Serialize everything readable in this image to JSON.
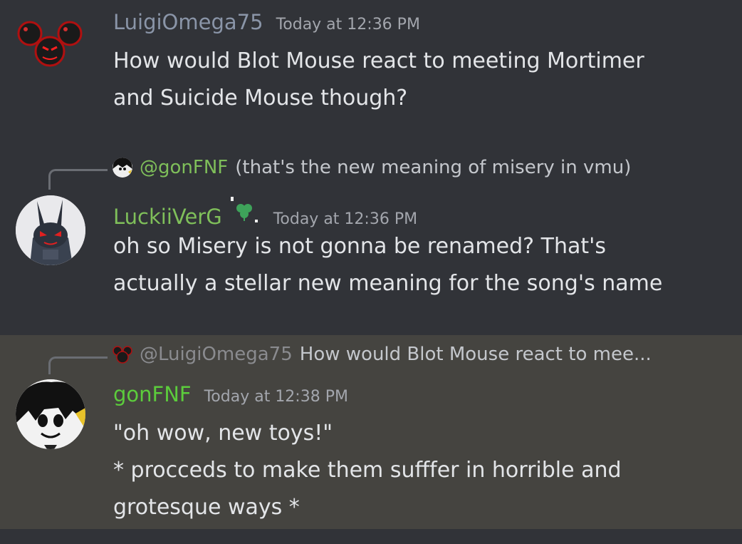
{
  "messages": [
    {
      "author": "LuigiOmega75",
      "author_color": "#8a95a8",
      "timestamp": "Today at 12:36 PM",
      "lines": [
        "How would Blot Mouse react to meeting Mortimer",
        "and Suicide Mouse though?"
      ]
    },
    {
      "reply": {
        "mention": "@gonFNF",
        "text": "(that's the new meaning of misery in vmu)"
      },
      "author": "LuckiiVerG",
      "author_color": "#7fbf5a",
      "timestamp": "Today at 12:36 PM",
      "lines": [
        "oh so Misery is not gonna be renamed? That's",
        "actually a stellar new meaning for the song's name"
      ]
    },
    {
      "reply": {
        "mention": "@LuigiOmega75",
        "text": "How would Blot Mouse react to mee..."
      },
      "author": "gonFNF",
      "author_color": "#5ccc3c",
      "timestamp": "Today at 12:38 PM",
      "lines": [
        "\"oh wow, new toys!\"",
        "* procceds to make them sufffer in horrible and",
        "grotesque ways *"
      ]
    }
  ],
  "colors": {
    "background": "#313338",
    "highlight_background": "#454440",
    "timestamp": "#a3a6ad",
    "text": "#e3e5e8"
  }
}
